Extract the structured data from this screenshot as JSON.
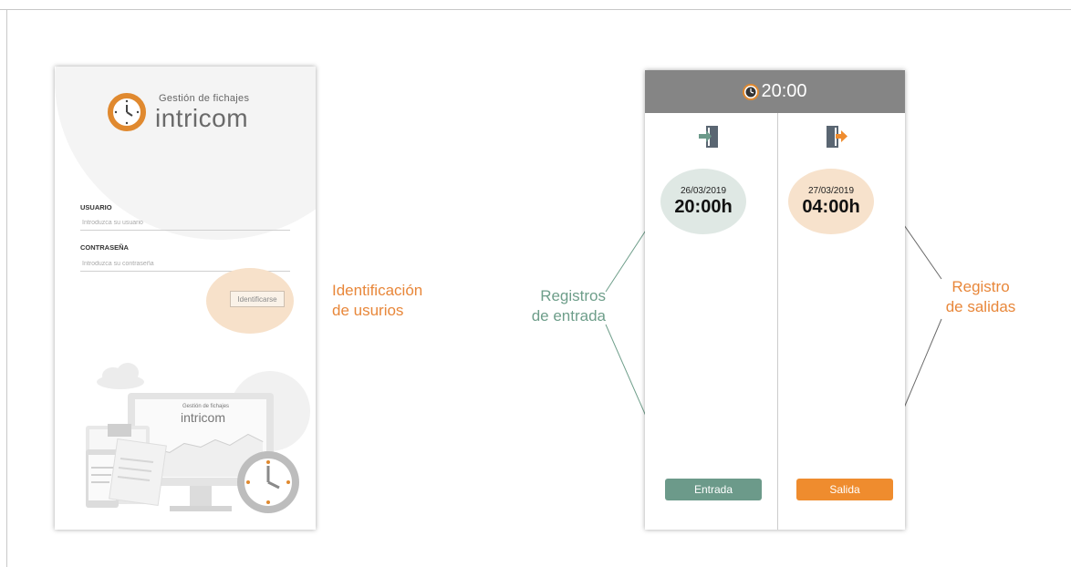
{
  "login": {
    "logo_subtitle": "Gestión de fichajes",
    "logo_name": "intricom",
    "user_label": "USUARIO",
    "user_placeholder": "Introduzca su usuario",
    "password_label": "CONTRASEÑA",
    "password_placeholder": "Introduzca su contraseña",
    "login_button": "Identificarse",
    "illustration_subtitle": "Gestión de fichajes",
    "illustration_name": "intricom"
  },
  "annotations": {
    "login_line1": "Identificación",
    "login_line2": "de usurios",
    "entries_line1": "Registros",
    "entries_line2": "de entrada",
    "exits_line1": "Registro",
    "exits_line2": "de salidas"
  },
  "clock": {
    "header_time": "20:00",
    "entry_date": "26/03/2019",
    "entry_hour": "20:00h",
    "exit_date": "27/03/2019",
    "exit_hour": "04:00h",
    "entry_button": "Entrada",
    "exit_button": "Salida"
  },
  "colors": {
    "accent_orange": "#e8873a",
    "accent_green": "#6c9a8a",
    "header_gray": "#858585"
  },
  "icons": {
    "logo": "clock-icon",
    "header": "clock-icon",
    "entry": "door-enter-icon",
    "exit": "door-exit-icon"
  }
}
